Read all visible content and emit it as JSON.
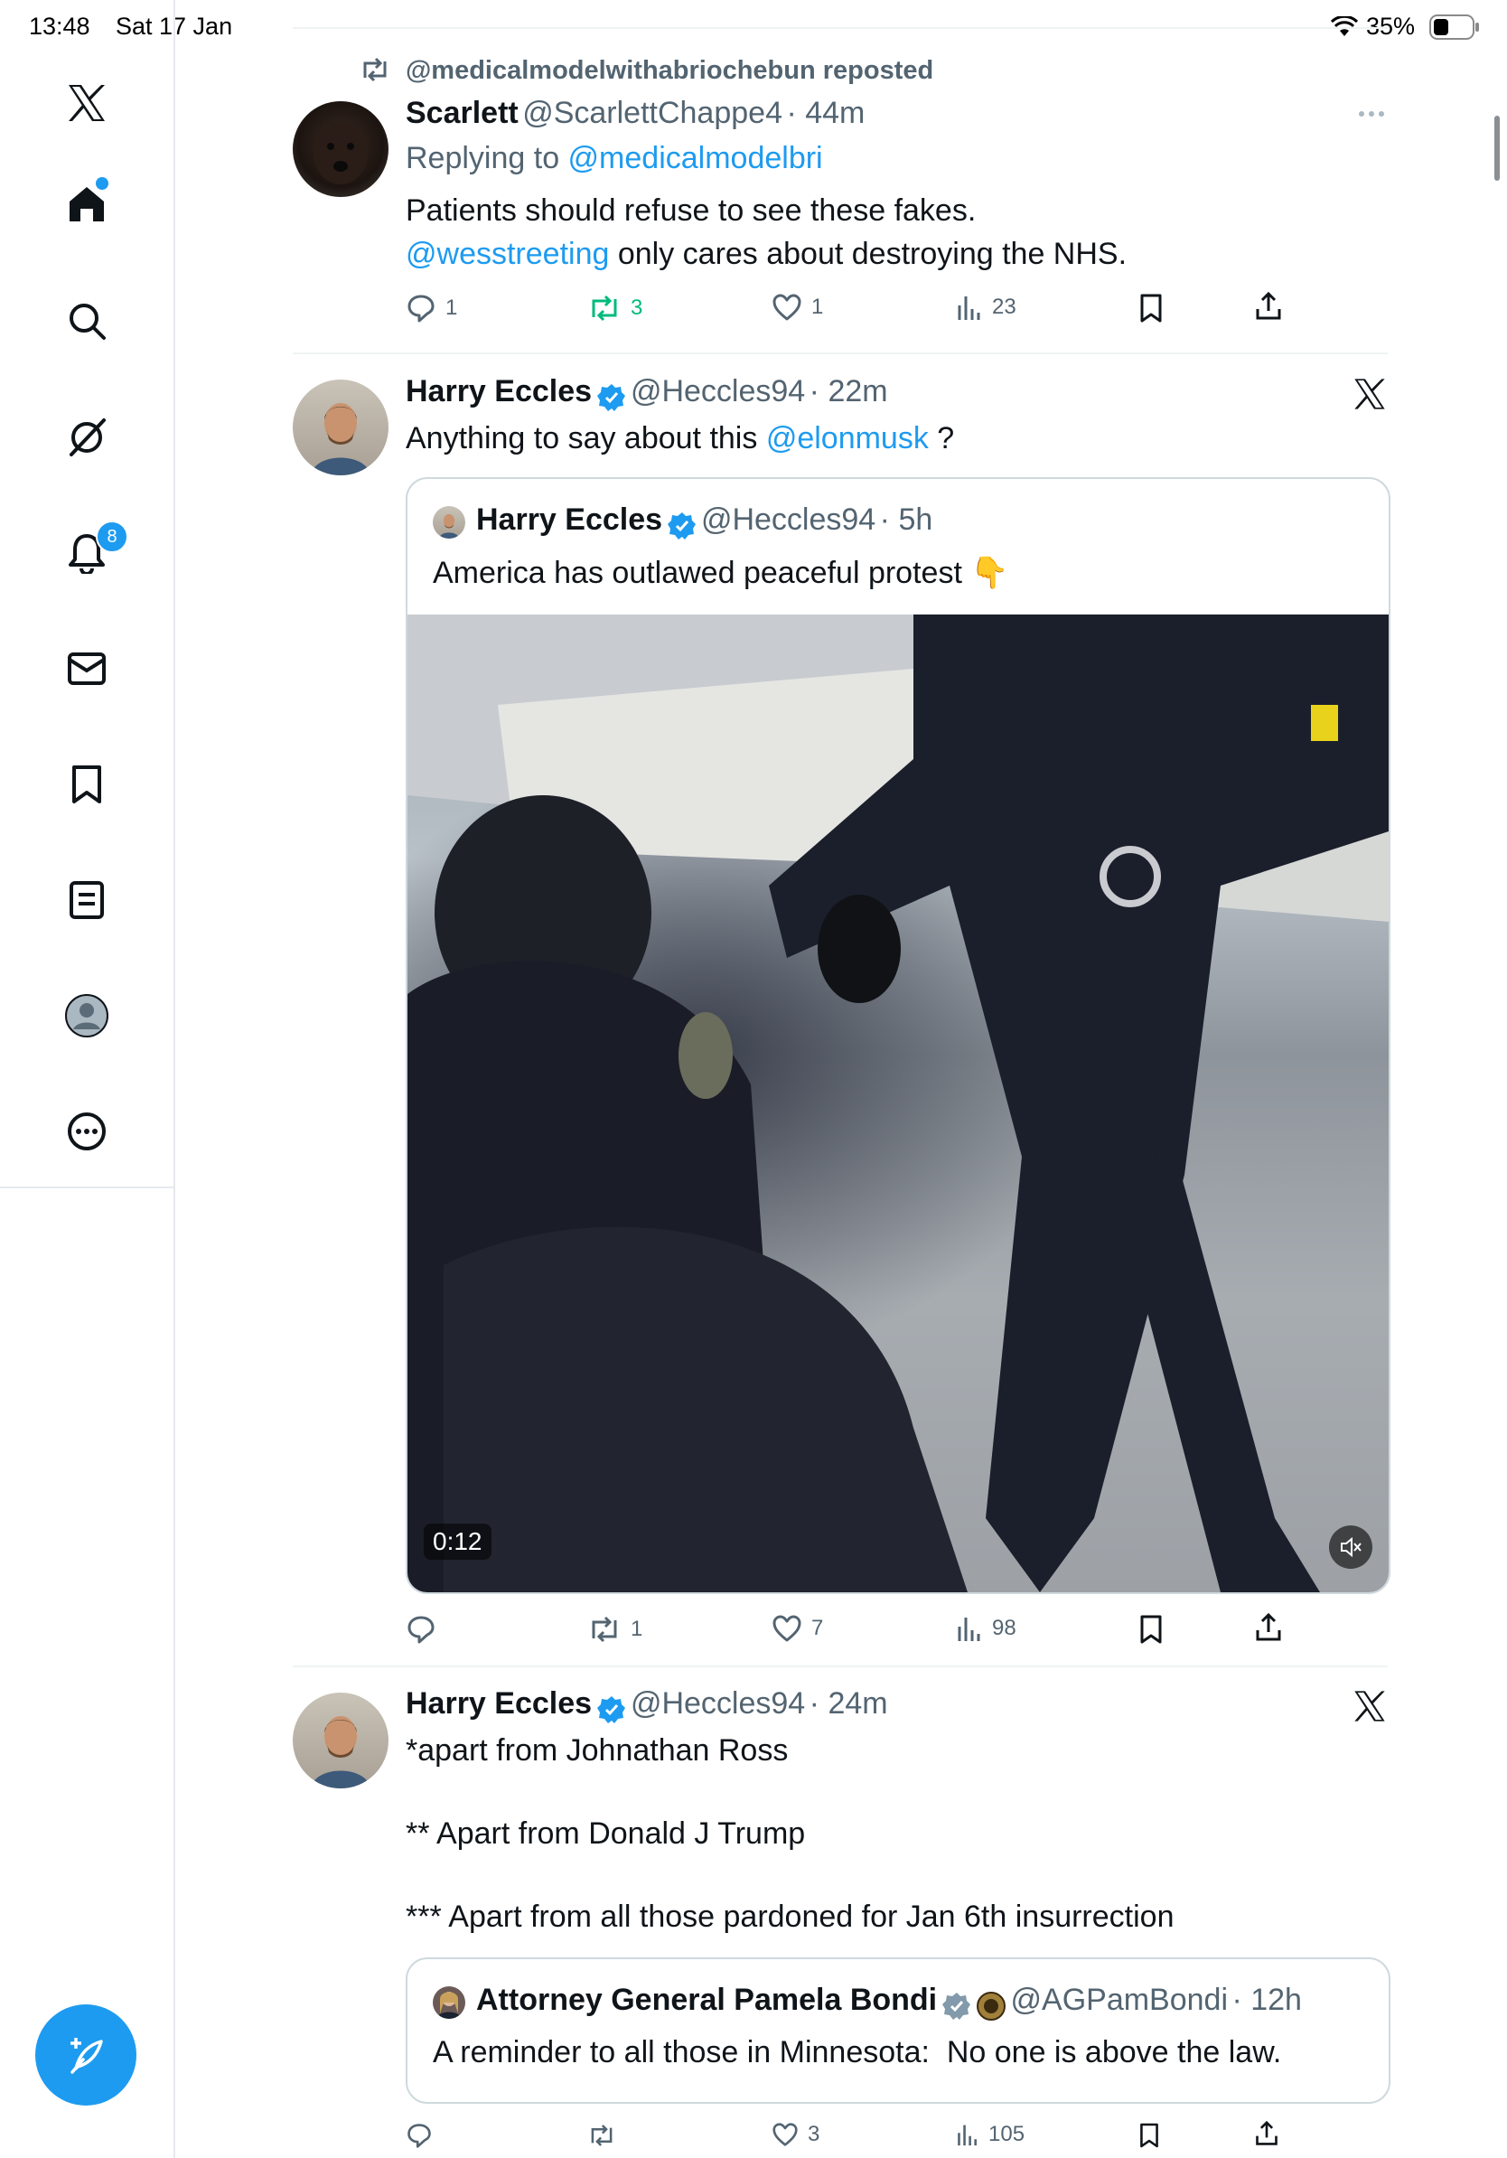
{
  "status_bar": {
    "time": "13:48",
    "date": "Sat 17 Jan",
    "battery": "35%"
  },
  "sidebar": {
    "items": [
      {
        "name": "x-logo-icon"
      },
      {
        "name": "home-icon"
      },
      {
        "name": "search-icon"
      },
      {
        "name": "grok-icon"
      },
      {
        "name": "notifications-icon",
        "badge": "8"
      },
      {
        "name": "messages-icon"
      },
      {
        "name": "bookmarks-icon"
      },
      {
        "name": "lists-icon"
      },
      {
        "name": "profile-icon"
      },
      {
        "name": "more-icon"
      }
    ]
  },
  "posts": [
    {
      "repost_label": "@medicalmodelwithabriochebun reposted",
      "name": "Scarlett",
      "handle": "@ScarlettChappe4",
      "time": "· 44m",
      "replying_prefix": "Replying to ",
      "replying_to": "@medicalmodelbri",
      "line1": "Patients should refuse to see these fakes.",
      "line2_link": "@wesstreeting",
      "line2_rest": " only cares about destroying the NHS.",
      "replies": "1",
      "reposts": "3",
      "likes": "1",
      "views": "23"
    },
    {
      "name": "Harry Eccles",
      "handle": "@Heccles94",
      "time": "· 22m",
      "text_prefix": "Anything to say about this ",
      "text_link": "@elonmusk",
      "text_suffix": " ?",
      "quote": {
        "name": "Harry Eccles",
        "handle": "@Heccles94",
        "time": "· 5h",
        "text": "America has outlawed peaceful protest 👇",
        "video_time": "0:12"
      },
      "replies": "",
      "reposts": "1",
      "likes": "7",
      "views": "98"
    },
    {
      "name": "Harry Eccles",
      "handle": "@Heccles94",
      "time": "· 24m",
      "line1": "*apart from Johnathan Ross",
      "line2": "** Apart from Donald J Trump",
      "line3": "*** Apart from all those pardoned for Jan 6th insurrection",
      "quote": {
        "name": "Attorney General Pamela Bondi",
        "handle": "@AGPamBondi",
        "time": "· 12h",
        "text": "A reminder to all those in Minnesota:  No one is above the law."
      },
      "replies": "",
      "reposts": "",
      "likes": "3",
      "views": "105"
    }
  ],
  "colors": {
    "accent": "#1d9bf0",
    "repost_green": "#00ba7c",
    "muted": "#536471"
  }
}
